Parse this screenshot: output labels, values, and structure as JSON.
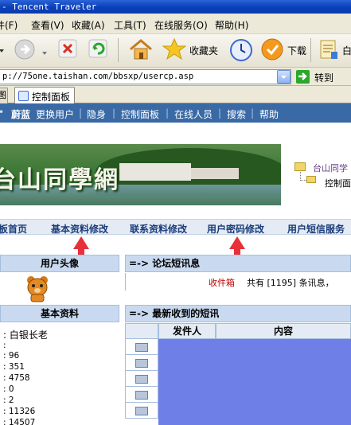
{
  "window": {
    "title": "- Tencent Traveler"
  },
  "menu": {
    "items": [
      "件(F)",
      "查看(V)",
      "收藏(A)",
      "工具(T)",
      "在线服务(O)",
      "帮助(H)"
    ]
  },
  "toolbar": {
    "favorites_label": "收藏夹",
    "download_label": "下载"
  },
  "address": {
    "url": "p://75one.taishan.com/bbsxp/usercp.asp",
    "go_label": "转到"
  },
  "tabs": {
    "active_label": "控制面板",
    "prev_label": "图"
  },
  "topnav": {
    "items": [
      "蔚蓝",
      "更换用户",
      "隐身",
      "控制面板",
      "在线人员",
      "搜索",
      "帮助"
    ]
  },
  "banner": {
    "title": "台山同學網"
  },
  "tree": {
    "root": "台山同学",
    "child": "控制面"
  },
  "subnav": {
    "items": [
      "板首页",
      "基本资料修改",
      "联系资料修改",
      "用户密码修改",
      "用户短信服务"
    ]
  },
  "left": {
    "avatar_header": "用户头像",
    "profile_header": "基本资料",
    "stats": [
      ": 白银长老",
      ":",
      ": 96",
      ": 351",
      ": 4758",
      ": 0",
      ": 2",
      ": 11326",
      ": 14507"
    ]
  },
  "right": {
    "forum_header": "=-> 论坛短讯息",
    "inbox_label": "收件箱",
    "inbox_text": "共有 [1195] 条讯息，",
    "latest_header": "=-> 最新收到的短讯",
    "col_sender": "发件人",
    "col_content": "内容"
  },
  "colors": {
    "nav_bg": "#3a6aa6",
    "panel_header": "#c9daf0",
    "arrow": "#e8303a",
    "message_fill": "#6f7fe8"
  }
}
